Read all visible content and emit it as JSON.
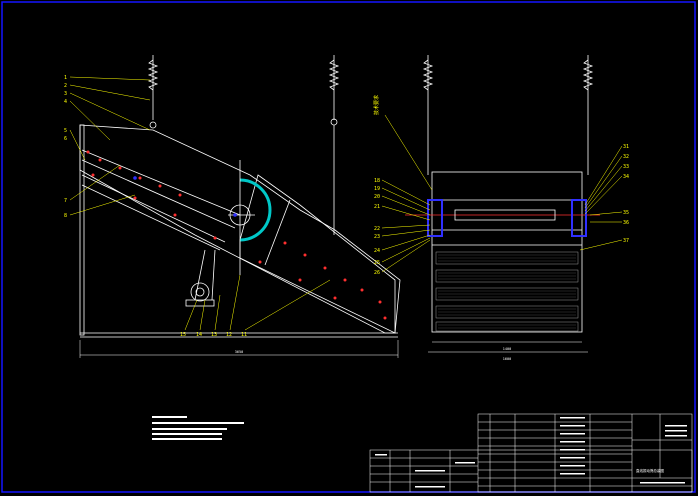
{
  "colors": {
    "background": "#000000",
    "frame": "#0000ff",
    "outline": "#ffffff",
    "leader": "#ffff00",
    "spring": "#ffffff",
    "accent_cyan": "#00c8c8",
    "accent_red": "#ff2020",
    "accent_blue": "#2020ff",
    "accent_green": "#00ff00"
  },
  "side_view": {
    "callouts_left": [
      "1",
      "2",
      "3",
      "4",
      "5",
      "6",
      "7",
      "8"
    ],
    "callouts_bottom": [
      "15",
      "14",
      "13",
      "12",
      "11"
    ]
  },
  "end_view": {
    "callouts_left": [
      "18",
      "19",
      "20",
      "21",
      "22",
      "23",
      "24",
      "25",
      "26"
    ],
    "callouts_right": [
      "31",
      "32",
      "33",
      "34",
      "35",
      "36",
      "37"
    ],
    "vertical_note": "技术要求"
  },
  "title_block": {
    "drawing_title": "直线振动筛总装图"
  }
}
